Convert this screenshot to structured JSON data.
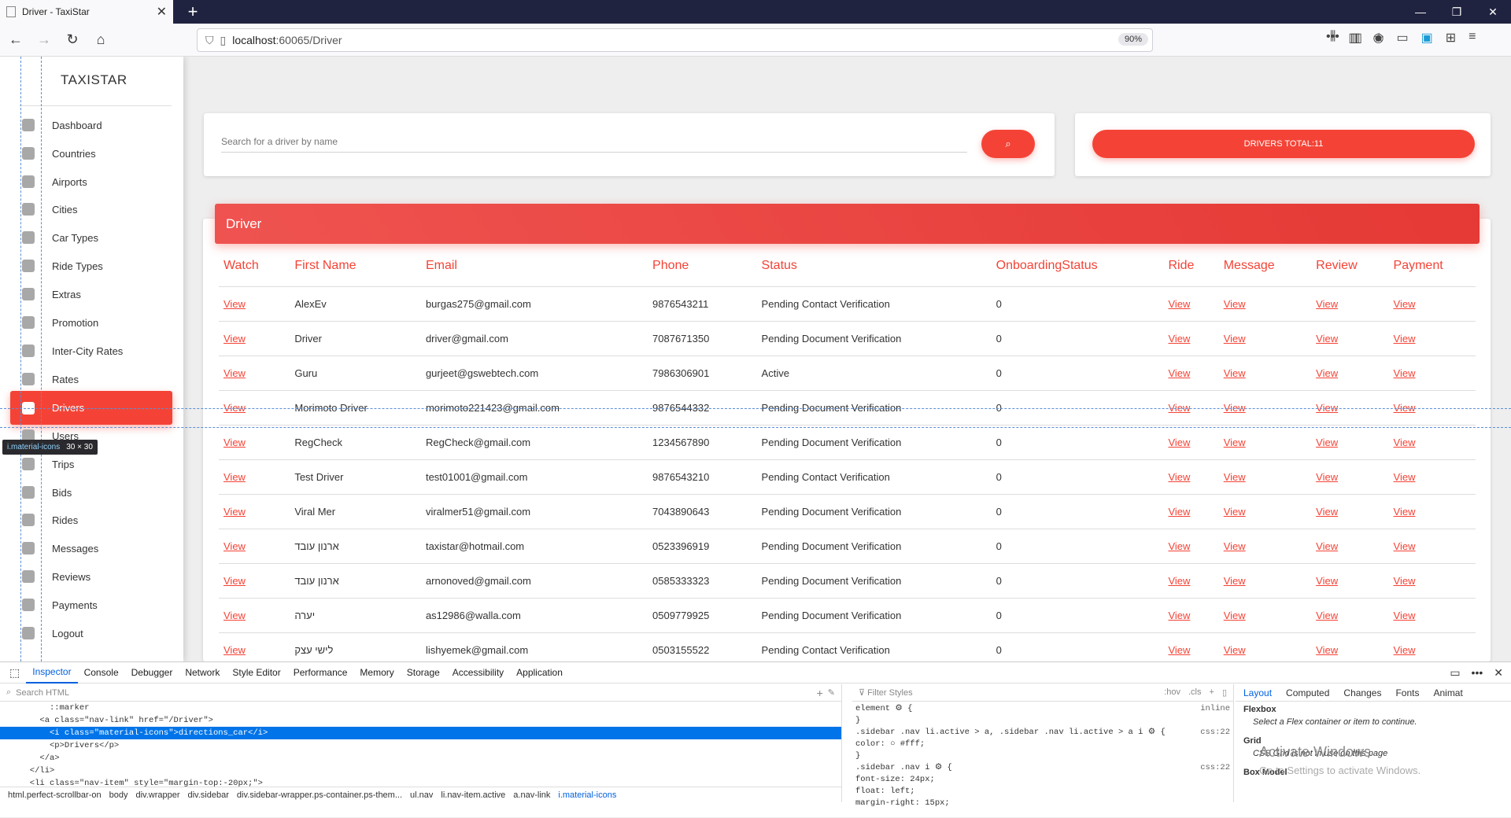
{
  "browser": {
    "tab_title": "Driver - TaxiStar",
    "url_host": "localhost",
    "url_path": ":60065/Driver",
    "zoom": "90%"
  },
  "sidebar": {
    "brand": "TAXISTAR",
    "items": [
      {
        "label": "Dashboard",
        "icon": "dashboard-icon"
      },
      {
        "label": "Countries",
        "icon": "globe-icon"
      },
      {
        "label": "Airports",
        "icon": "airplane-icon"
      },
      {
        "label": "Cities",
        "icon": "city-icon"
      },
      {
        "label": "Car Types",
        "icon": "car-icon"
      },
      {
        "label": "Ride Types",
        "icon": "seat-icon"
      },
      {
        "label": "Extras",
        "icon": "extras-icon"
      },
      {
        "label": "Promotion",
        "icon": "promotion-icon"
      },
      {
        "label": "Inter-City Rates",
        "icon": "crop-icon"
      },
      {
        "label": "Rates",
        "icon": "rates-icon"
      },
      {
        "label": "Drivers",
        "icon": "directions-car-icon"
      },
      {
        "label": "Users",
        "icon": "users-icon"
      },
      {
        "label": "Trips",
        "icon": "map-icon"
      },
      {
        "label": "Bids",
        "icon": "checkbox-icon"
      },
      {
        "label": "Rides",
        "icon": "bus-icon"
      },
      {
        "label": "Messages",
        "icon": "message-icon"
      },
      {
        "label": "Reviews",
        "icon": "review-icon"
      },
      {
        "label": "Payments",
        "icon": "dollar-icon"
      },
      {
        "label": "Logout",
        "icon": "power-icon"
      }
    ],
    "active": "Drivers"
  },
  "tooltip": {
    "class": "i.material-icons",
    "size": "30 × 30"
  },
  "search": {
    "placeholder": "Search for a driver by name"
  },
  "total_label": "DRIVERS TOTAL:11",
  "card_title": "Driver",
  "table": {
    "headers": [
      "Watch",
      "First Name",
      "Email",
      "Phone",
      "Status",
      "OnboardingStatus",
      "Ride",
      "Message",
      "Review",
      "Payment"
    ],
    "link_label": "View",
    "rows": [
      {
        "name": "AlexEv",
        "email": "burgas275@gmail.com",
        "phone": "9876543211",
        "status": "Pending Contact Verification",
        "onboarding": "0"
      },
      {
        "name": "Driver",
        "email": "driver@gmail.com",
        "phone": "7087671350",
        "status": "Pending Document Verification",
        "onboarding": "0"
      },
      {
        "name": "Guru",
        "email": "gurjeet@gswebtech.com",
        "phone": "7986306901",
        "status": "Active",
        "onboarding": "0"
      },
      {
        "name": "Morimoto Driver",
        "email": "morimoto221423@gmail.com",
        "phone": "9876544332",
        "status": "Pending Document Verification",
        "onboarding": "0"
      },
      {
        "name": "RegCheck",
        "email": "RegCheck@gmail.com",
        "phone": "1234567890",
        "status": "Pending Document Verification",
        "onboarding": "0"
      },
      {
        "name": "Test Driver",
        "email": "test01001@gmail.com",
        "phone": "9876543210",
        "status": "Pending Contact Verification",
        "onboarding": "0"
      },
      {
        "name": "Viral Mer",
        "email": "viralmer51@gmail.com",
        "phone": "7043890643",
        "status": "Pending Document Verification",
        "onboarding": "0"
      },
      {
        "name": "ארנון עובד",
        "email": "taxistar@hotmail.com",
        "phone": "0523396919",
        "status": "Pending Document Verification",
        "onboarding": "0"
      },
      {
        "name": "ארנון עובד",
        "email": "arnonoved@gmail.com",
        "phone": "0585333323",
        "status": "Pending Document Verification",
        "onboarding": "0"
      },
      {
        "name": "יערה",
        "email": "as12986@walla.com",
        "phone": "0509779925",
        "status": "Pending Document Verification",
        "onboarding": "0"
      },
      {
        "name": "לישי עצק",
        "email": "lishyemek@gmail.com",
        "phone": "0503155522",
        "status": "Pending Contact Verification",
        "onboarding": "0"
      }
    ]
  },
  "devtools": {
    "tabs": [
      "Inspector",
      "Console",
      "Debugger",
      "Network",
      "Style Editor",
      "Performance",
      "Memory",
      "Storage",
      "Accessibility",
      "Application"
    ],
    "active_tab": "Inspector",
    "search_html": "Search HTML",
    "filter_styles": "Filter Styles",
    "hov": ":hov",
    "cls": ".cls",
    "html_lines": [
      "          ::marker",
      "        <a class=\"nav-link\" href=\"/Driver\">",
      "          <i class=\"material-icons\">directions_car</i>",
      "          <p>Drivers</p>",
      "        </a>",
      "      </li>",
      "      <li class=\"nav-item\" style=\"margin-top:-20px;\">"
    ],
    "breadcrumbs": [
      "html.perfect-scrollbar-on",
      "body",
      "div.wrapper",
      "div.sidebar",
      "div.sidebar-wrapper.ps-container.ps-them...",
      "ul.nav",
      "li.nav-item.active",
      "a.nav-link",
      "i.material-icons"
    ],
    "rules": [
      {
        "sel": "element ⚙ {",
        "src": "inline"
      },
      {
        "sel": "}",
        "src": ""
      },
      {
        "sel": ".sidebar .nav li.active > a, .sidebar .nav li.active > a i ⚙ {",
        "src": "css:22"
      },
      {
        "sel": "  color: ○ #fff;",
        "src": ""
      },
      {
        "sel": "}",
        "src": ""
      },
      {
        "sel": ".sidebar .nav i ⚙ {",
        "src": "css:22"
      },
      {
        "sel": "  font-size: 24px;",
        "src": ""
      },
      {
        "sel": "  float: left;",
        "src": ""
      },
      {
        "sel": "  margin-right: 15px;",
        "src": ""
      }
    ],
    "layout_tabs": [
      "Layout",
      "Computed",
      "Changes",
      "Fonts",
      "Animat"
    ],
    "flexbox_title": "Flexbox",
    "flexbox_text": "Select a Flex container or item to continue.",
    "grid_title": "Grid",
    "grid_text": "CSS Grid is not in use on this page",
    "boxmodel_title": "Box Model",
    "watermark": "Activate Windows",
    "watermark_sub": "Go to Settings to activate Windows."
  }
}
